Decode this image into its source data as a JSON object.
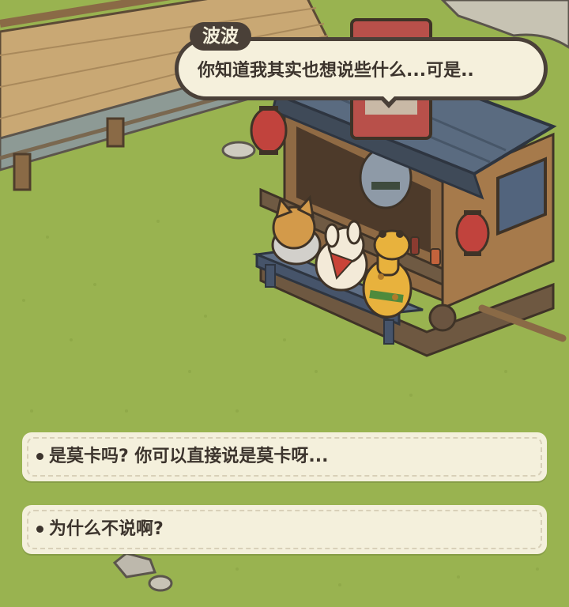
{
  "dialogue": {
    "speaker": "波波",
    "line": "你知道我其实也想说些什么...可是.."
  },
  "options": [
    {
      "label": "是莫卡吗? 你可以直接说是莫卡呀..."
    },
    {
      "label": "为什么不说啊?"
    }
  ],
  "colors": {
    "grass": "#99b350",
    "bubble_fill": "#f5f0dc",
    "bubble_outline": "#4a4038",
    "text": "#3c342d"
  }
}
